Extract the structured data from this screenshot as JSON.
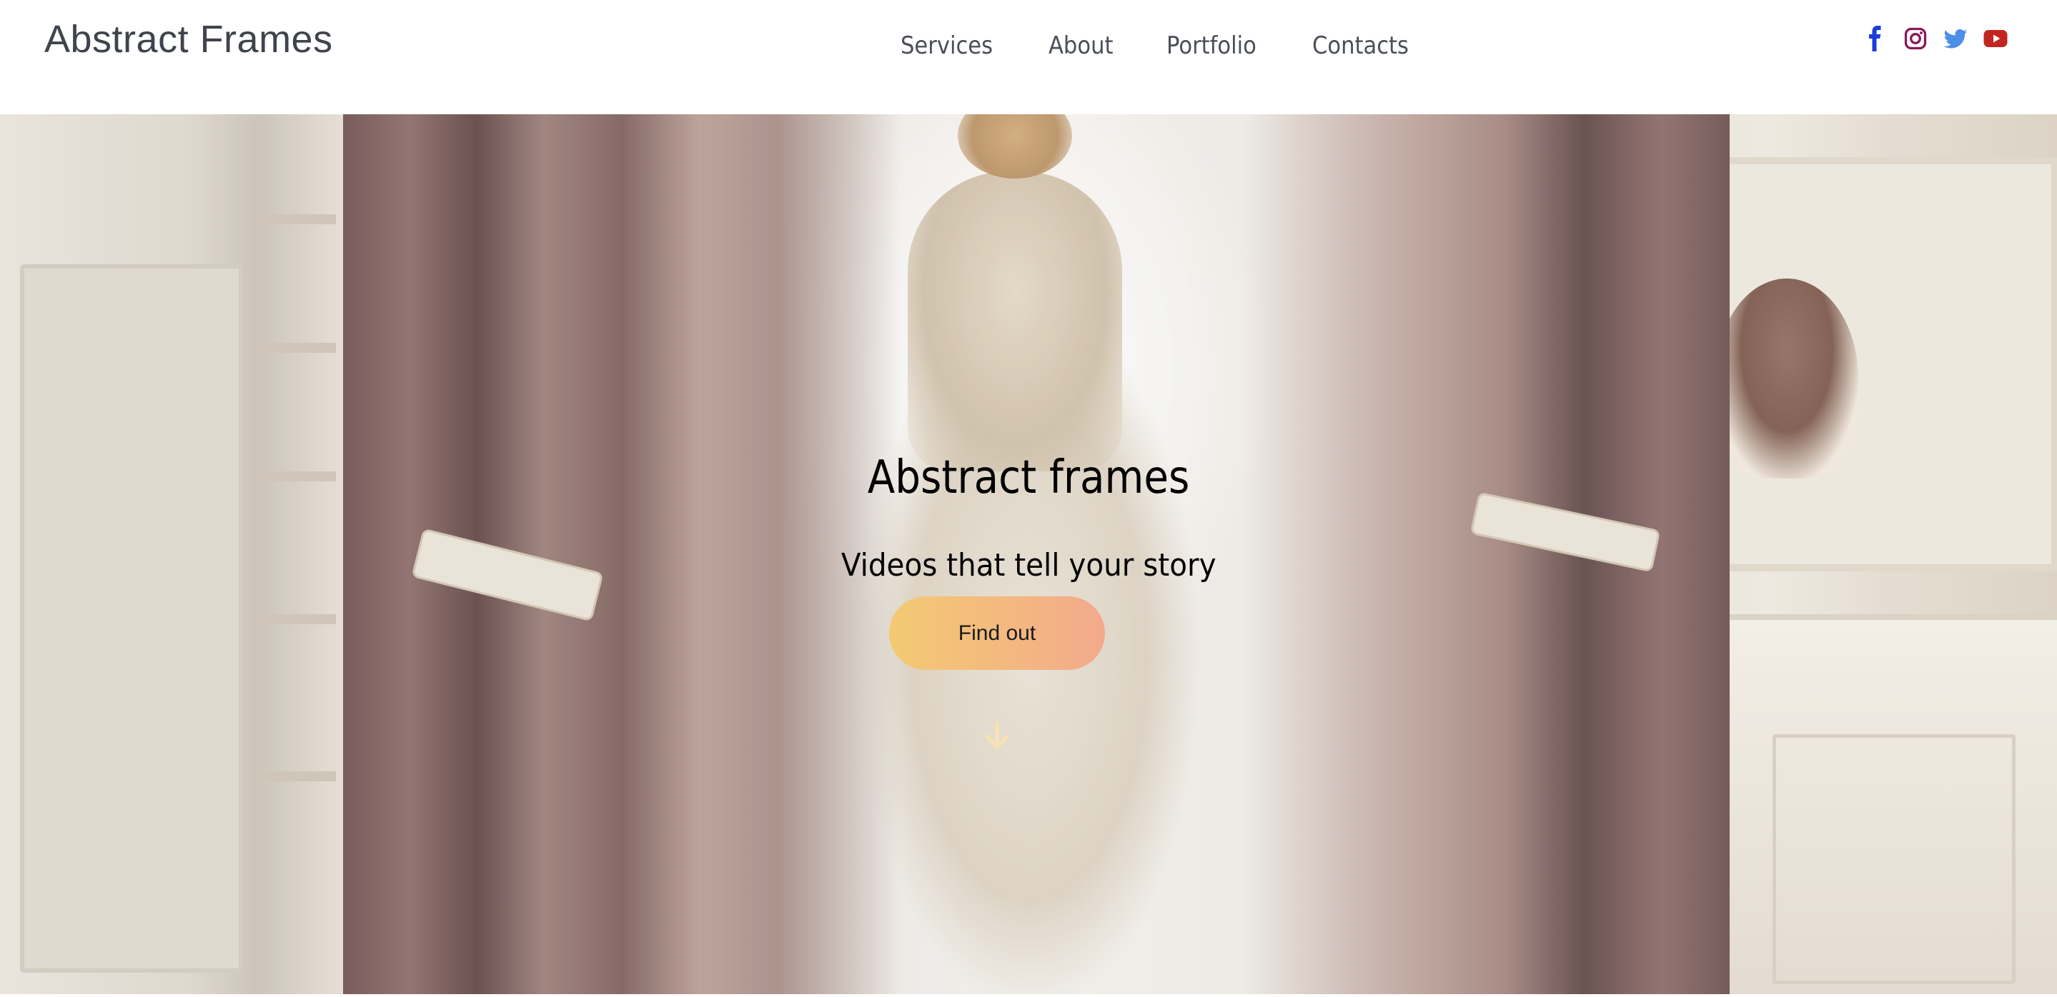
{
  "header": {
    "logo": "Abstract Frames",
    "nav": [
      "Services",
      "About",
      "Portfolio",
      "Contacts"
    ],
    "social": [
      {
        "icon": "facebook-icon",
        "color": "#1a3cd8"
      },
      {
        "icon": "instagram-icon",
        "color": "#8a1a5a"
      },
      {
        "icon": "twitter-icon",
        "color": "#4d8ee8"
      },
      {
        "icon": "youtube-icon",
        "color": "#c0261f"
      }
    ]
  },
  "hero": {
    "title": "Abstract frames",
    "subtitle": "Videos that tell your story",
    "cta_label": "Find out",
    "cta_gradient": [
      "#f3ca72",
      "#f3aa8c"
    ],
    "scroll_icon": "arrow-down-icon",
    "scroll_icon_color": "#f6e2b4"
  }
}
